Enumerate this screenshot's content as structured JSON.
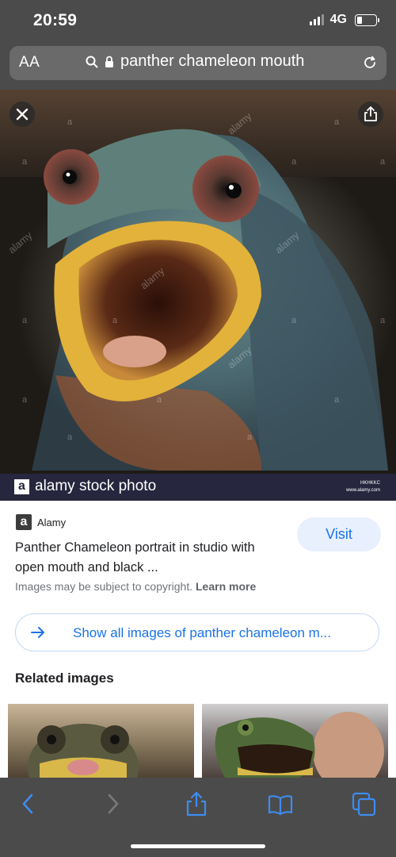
{
  "status": {
    "time": "20:59",
    "network": "4G"
  },
  "address_bar": {
    "text_size_label": "AA",
    "url_text": "panther chameleon mouth"
  },
  "hero": {
    "icons": [
      "close-icon",
      "share-icon"
    ],
    "watermark": "alamy",
    "watermark_letter": "a"
  },
  "banner": {
    "logo": "a",
    "text": "alamy stock photo",
    "code": "HKHKKC",
    "site": "www.alamy.com"
  },
  "result": {
    "source_logo": "a",
    "source_name": "Alamy",
    "visit_label": "Visit",
    "title": "Panther Chameleon portrait in studio with open mouth and black ...",
    "copyright_text": "Images may be subject to copyright.",
    "learn_more": "Learn more"
  },
  "show_all": {
    "label": "Show all images of panther chameleon m..."
  },
  "related": {
    "heading": "Related images"
  },
  "toolbar": {
    "icons": [
      "back-icon",
      "forward-icon",
      "share-icon",
      "bookmarks-icon",
      "tabs-icon"
    ]
  },
  "colors": {
    "accent": "#1a73e8",
    "visit_bg": "#e8f0fe",
    "chrome": "#4b4b4b",
    "banner": "#26263e"
  }
}
